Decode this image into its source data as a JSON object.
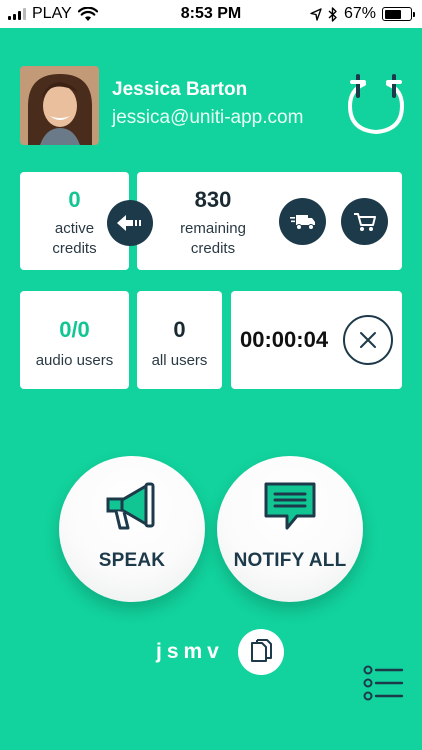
{
  "status_bar": {
    "carrier": "PLAY",
    "time": "8:53 PM",
    "battery": "67%",
    "battery_level": 0.67
  },
  "profile": {
    "name": "Jessica Barton",
    "email": "jessica@uniti-app.com"
  },
  "credits": {
    "active_value": "0",
    "active_label_line1": "active",
    "active_label_line2": "credits",
    "remaining_value": "830",
    "remaining_label_line1": "remaining",
    "remaining_label_line2": "credits"
  },
  "stats": {
    "audio_users_value": "0/0",
    "audio_users_label": "audio users",
    "all_users_value": "0",
    "all_users_label": "all users",
    "timer": "00:00:04"
  },
  "actions": {
    "speak_label": "SPEAK",
    "notify_label": "NOTIFY ALL"
  },
  "footer": {
    "room_code": "jsmv"
  },
  "colors": {
    "background": "#12d39d",
    "accent_dark": "#1d3a4b",
    "accent_green": "#12c694"
  },
  "icons": {
    "logout": "logout-icon",
    "transfer": "arrow-left-icon",
    "delivery": "delivery-truck-icon",
    "cart": "shopping-cart-icon",
    "cancel": "close-icon",
    "speak": "megaphone-icon",
    "notify": "chat-bubble-icon",
    "copy": "copy-icon",
    "menu": "menu-list-icon"
  }
}
